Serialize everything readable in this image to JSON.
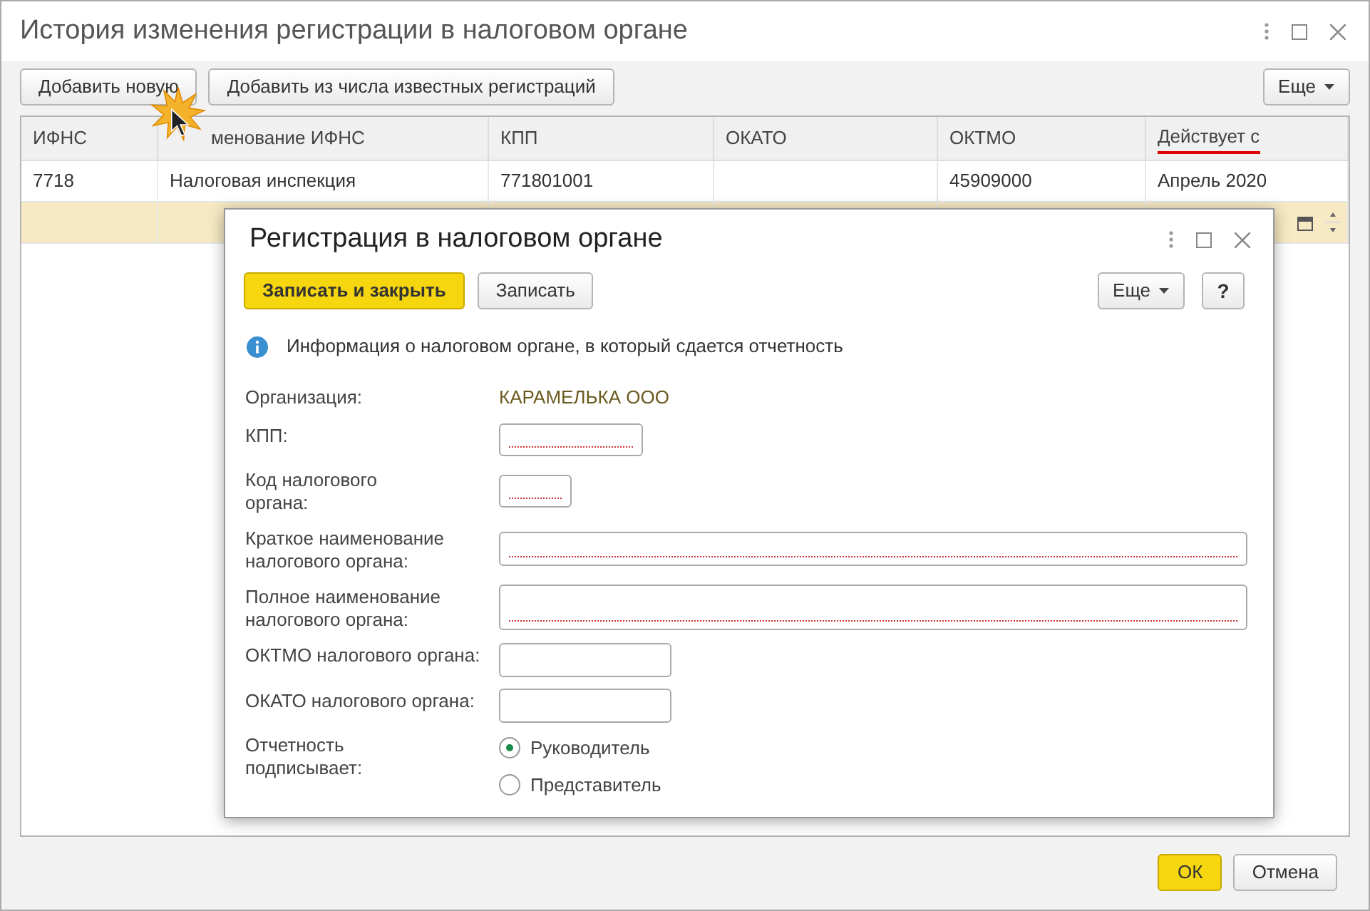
{
  "window": {
    "title": "История изменения регистрации в налоговом органе"
  },
  "toolbar": {
    "buttons": [
      "Добавить новую",
      "Добавить из числа известных регистраций"
    ],
    "more": "Еще"
  },
  "table": {
    "columns": [
      {
        "label": "ИФНС",
        "marked": false
      },
      {
        "label": "менование ИФНС",
        "marked": false
      },
      {
        "label": "КПП",
        "marked": false
      },
      {
        "label": "ОКАТО",
        "marked": false
      },
      {
        "label": "ОКТМО",
        "marked": false
      },
      {
        "label": "Действует с",
        "marked": true
      }
    ],
    "rows": [
      {
        "selected": false,
        "cells": [
          "7718",
          "Налоговая инспекция",
          "771801001",
          "",
          "45909000",
          "Апрель 2020"
        ]
      },
      {
        "selected": true,
        "cells": [
          "",
          "",
          "",
          "",
          "",
          ""
        ]
      }
    ]
  },
  "dialog": {
    "title": "Регистрация в налоговом органе",
    "primary_button": "Записать и закрыть",
    "save_button": "Записать",
    "more": "Еще",
    "help": "?",
    "info": "Информация о налоговом органе, в который сдается отчетность",
    "organization": {
      "label": "Организация:",
      "value": "КАРАМЕЛЬКА ООО"
    },
    "fields": [
      {
        "label": "КПП:",
        "required": true
      },
      {
        "label": "Код налогового органа:",
        "required": true
      },
      {
        "label": "Краткое наименование налогового органа:",
        "required": true
      },
      {
        "label": "Полное наименование налогового органа:",
        "required": true
      },
      {
        "label": "ОКТМО налогового органа:",
        "required": false
      },
      {
        "label": "ОКАТО налогового органа:",
        "required": false
      }
    ],
    "signer": {
      "label": "Отчетность подписывает:",
      "options": [
        {
          "label": "Руководитель",
          "selected": true
        },
        {
          "label": "Представитель",
          "selected": false
        }
      ]
    }
  },
  "footer": {
    "ok": "ОК",
    "cancel": "Отмена"
  }
}
